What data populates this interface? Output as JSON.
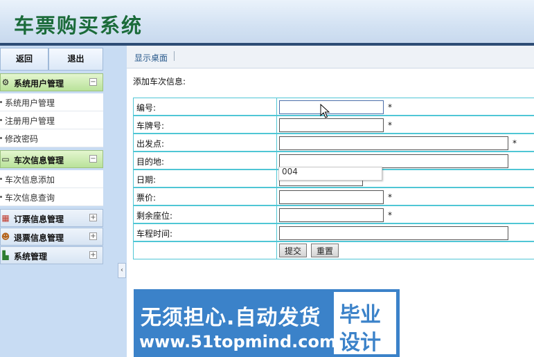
{
  "app_title": "车票购买系统",
  "sidebar": {
    "top_buttons": {
      "back": "返回",
      "logout": "退出"
    },
    "groups": [
      {
        "label": "系统用户管理",
        "icon": "gear-icon",
        "expanded_symbol": "−",
        "items": [
          "系统用户管理",
          "注册用户管理",
          "修改密码"
        ]
      },
      {
        "label": "车次信息管理",
        "icon": "monitor-icon",
        "expanded_symbol": "−",
        "items": [
          "车次信息添加",
          "车次信息查询"
        ]
      },
      {
        "label": "订票信息管理",
        "icon": "calendar-icon",
        "expanded_symbol": "+"
      },
      {
        "label": "退票信息管理",
        "icon": "person-icon",
        "expanded_symbol": "+"
      },
      {
        "label": "系统管理",
        "icon": "chart-icon",
        "expanded_symbol": "+"
      }
    ],
    "collapse_arrow": "‹"
  },
  "breadcrumb": "显示桌面",
  "form": {
    "title": "添加车次信息:",
    "fields": [
      {
        "label": "编号:",
        "value": "",
        "required": "*"
      },
      {
        "label": "车牌号:",
        "value": "",
        "required": "*"
      },
      {
        "label": "出发点:",
        "value": "",
        "required": "*"
      },
      {
        "label": "目的地:",
        "value": "",
        "required": ""
      },
      {
        "label": "日期:",
        "value": "",
        "required": "*"
      },
      {
        "label": "票价:",
        "value": "",
        "required": "*"
      },
      {
        "label": "剩余座位:",
        "value": "",
        "required": "*"
      },
      {
        "label": "车程时间:",
        "value": "",
        "required": ""
      }
    ],
    "submit": "提交",
    "reset": "重置",
    "autocomplete_option": "004"
  },
  "banner": {
    "line1": "无须担心.自动发货",
    "line2": "www.51topmind.com",
    "badge_line1": "毕业",
    "badge_line2": "设计"
  },
  "colors": {
    "accent_green": "#1b6b3a",
    "header_bar": "#2d4c75",
    "table_border": "#4fc6d5",
    "banner_blue": "#3b82c9"
  }
}
